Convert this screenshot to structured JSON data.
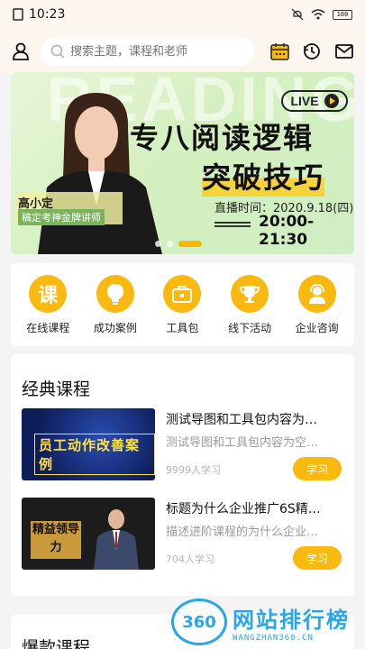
{
  "status_bar": {
    "time": "10:23",
    "battery": "100"
  },
  "search": {
    "placeholder": "搜索主题，课程和老师"
  },
  "banner": {
    "bg_word": "READING",
    "live": "LIVE",
    "title_line1": "专八阅读逻辑",
    "title_line2": "突破技巧",
    "host_name": "高小定",
    "host_title": "稿定考神金牌讲师",
    "schedule_label": "直播时间：2020.9.18(四)",
    "schedule_time": "20:00-21:30",
    "active_slide": 3,
    "slide_count": 3
  },
  "categories": [
    {
      "label": "在线课程",
      "icon": "course-icon",
      "glyph": "课"
    },
    {
      "label": "成功案例",
      "icon": "lightbulb-icon",
      "glyph": ""
    },
    {
      "label": "工具包",
      "icon": "toolbox-icon",
      "glyph": ""
    },
    {
      "label": "线下活动",
      "icon": "trophy-icon",
      "glyph": ""
    },
    {
      "label": "企业咨询",
      "icon": "consultant-icon",
      "glyph": ""
    }
  ],
  "classic": {
    "title": "经典课程",
    "courses": [
      {
        "thumb_text": "员工动作改善案例",
        "title": "测试导图和工具包内容为…",
        "desc": "测试导图和工具包内容为空…",
        "learners": "9999人学习",
        "button": "学习"
      },
      {
        "thumb_text": "精益领导力",
        "title": "标题为什么企业推广6S精…",
        "desc": "描述进阶课程的为什么企业…",
        "learners": "704人学习",
        "button": "学习"
      }
    ]
  },
  "hot": {
    "title": "爆款课程"
  },
  "watermark": {
    "logo": "360",
    "main": "网站排行榜",
    "sub": "WANGZHAN360.CN"
  },
  "colors": {
    "accent": "#f9b90f",
    "header_bg": "#fdf6ef",
    "banner_green": "#d5f0c0"
  }
}
